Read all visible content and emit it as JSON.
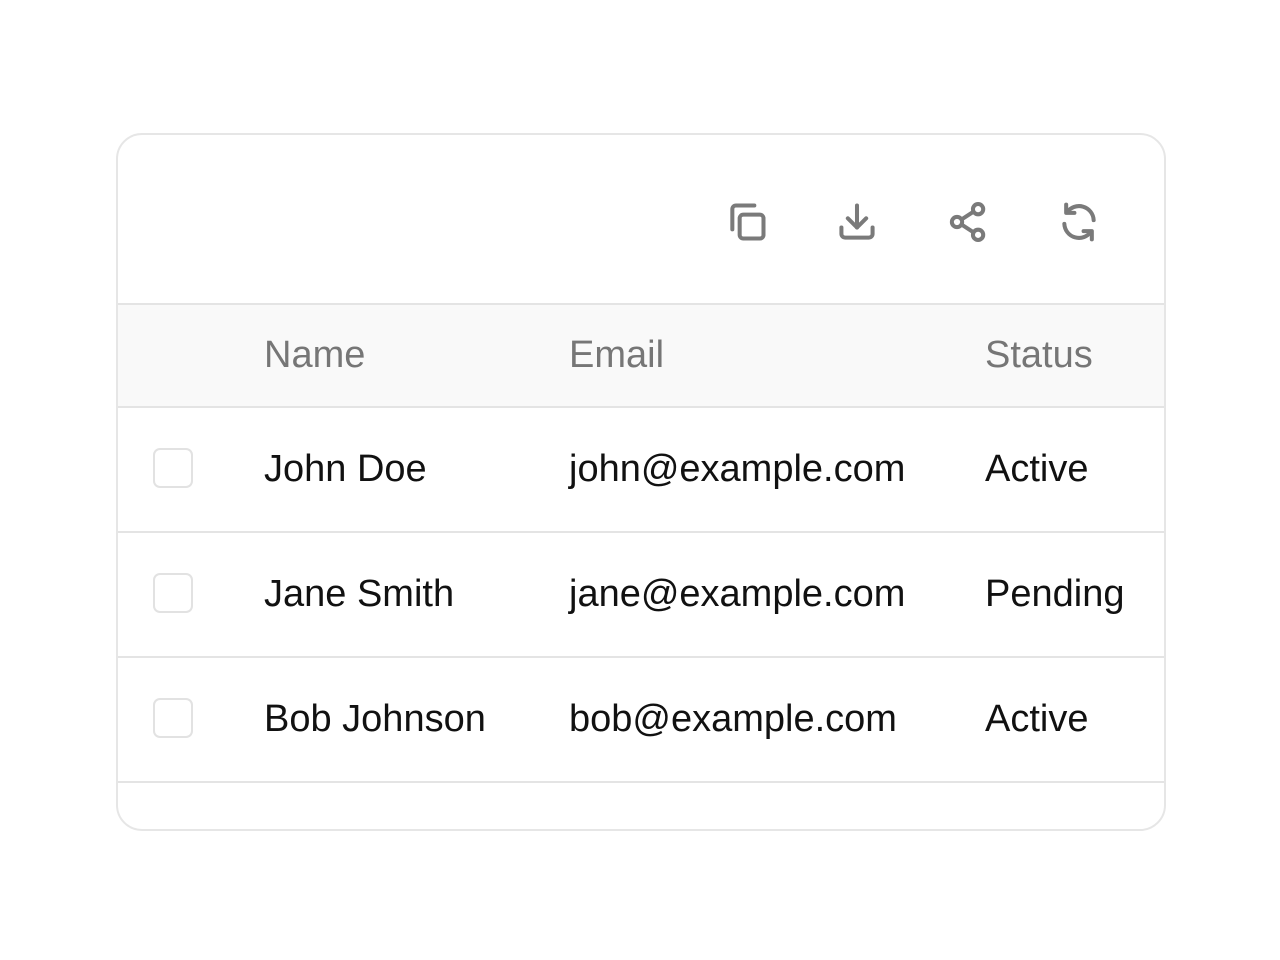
{
  "toolbar": {
    "icons": [
      "copy-icon",
      "download-icon",
      "share-icon",
      "refresh-icon"
    ]
  },
  "table": {
    "columns": [
      "Name",
      "Email",
      "Status"
    ],
    "rows": [
      {
        "name": "John Doe",
        "email": "john@example.com",
        "status": "Active",
        "checked": false
      },
      {
        "name": "Jane Smith",
        "email": "jane@example.com",
        "status": "Pending",
        "checked": false
      },
      {
        "name": "Bob Johnson",
        "email": "bob@example.com",
        "status": "Active",
        "checked": false
      }
    ]
  },
  "colors": {
    "border": "#e4e4e4",
    "header_bg": "#f9f9f9",
    "header_text": "#767676",
    "icon": "#7a7a7a",
    "cell_text": "#111111"
  }
}
